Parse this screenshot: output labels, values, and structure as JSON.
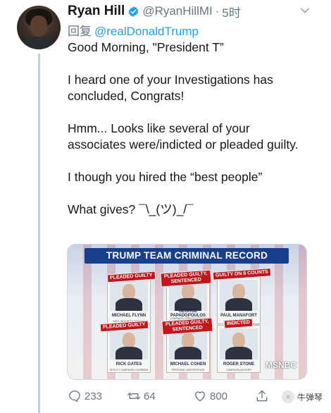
{
  "author": {
    "name": "Ryan Hill",
    "handle": "@RyanHillMI",
    "separator": "·",
    "time": "5时"
  },
  "reply": {
    "label": "回复",
    "mention": "@realDonaldTrump"
  },
  "tweet": {
    "paragraphs": [
      "Good Morning, \"President T”",
      "I heard one of your Investigations has concluded, Congrats!",
      "Hmm... Looks like several of your associates were/indicted or pleaded guilty.",
      "I though you hired the “best people”",
      "What gives? ¯\\_(ツ)_/¯"
    ]
  },
  "media": {
    "title": "TRUMP TEAM CRIMINAL RECORD",
    "network": "MSNBC",
    "cards": [
      {
        "badge": "PLEADED GUILTY",
        "name": "MICHAEL FLYNN",
        "role": "NAT'L SECURITY ADVISER"
      },
      {
        "badge": "PLEADED GUILTY, SENTENCED",
        "name": "GEORGE PAPADOPOULOS",
        "role": "CAMPAIGN FOREIGN POLICY ADVISER"
      },
      {
        "badge": "GUILTY ON 8 COUNTS",
        "name": "PAUL MANAFORT",
        "role": "CAMPAIGN CHAIRMAN"
      },
      {
        "badge": "PLEADED GUILTY",
        "name": "RICK GATES",
        "role": "DEPUTY CAMPAIGN CHAIRMAN"
      },
      {
        "badge": "PLEADED GUILTY, SENTENCED",
        "name": "MICHAEL COHEN",
        "role": "PERSONAL LAWYER/FIXER"
      },
      {
        "badge": "INDICTED",
        "name": "ROGER STONE",
        "role": "CAMPAIGN ADVISER"
      }
    ]
  },
  "actions": {
    "replies": "233",
    "retweets": "64",
    "likes": "800"
  },
  "watermark": {
    "text": "牛弹琴"
  },
  "colors": {
    "link": "#1da1f2",
    "muted": "#657786",
    "verified": "#1da1f2",
    "badge": "#c2161d",
    "title_bar": "#1a3f8a"
  },
  "icons": [
    "verified-badge-icon",
    "chevron-down-icon",
    "reply-icon",
    "retweet-icon",
    "like-icon",
    "share-icon"
  ]
}
